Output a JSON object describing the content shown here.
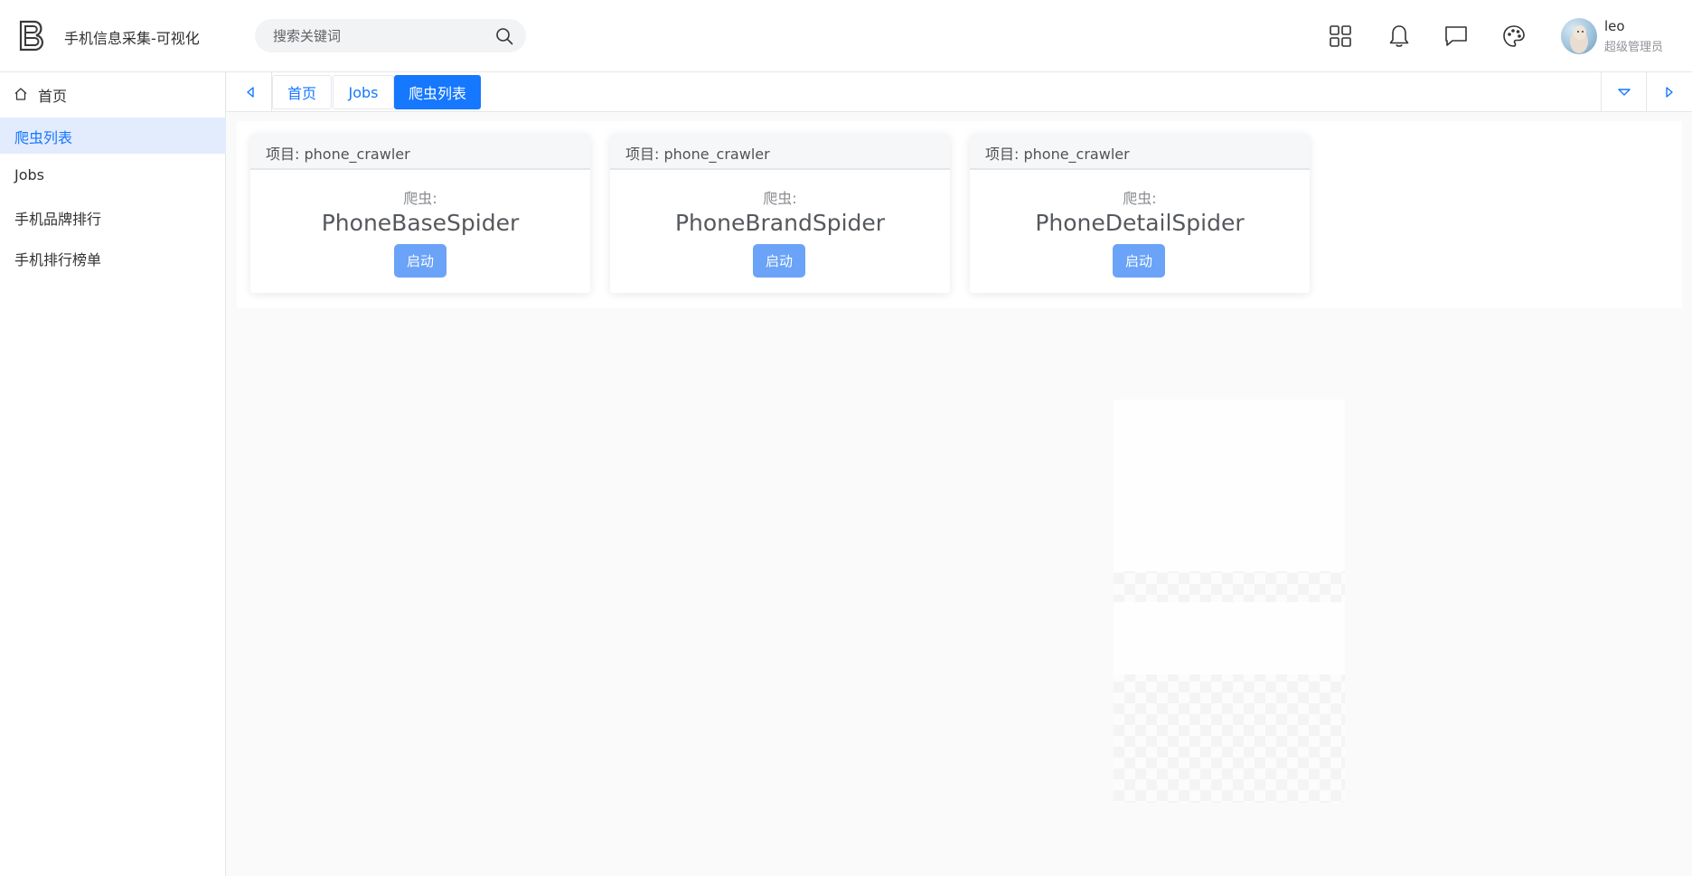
{
  "header": {
    "app_title": "手机信息采集-可视化",
    "search_placeholder": "搜索关键词",
    "icons": [
      "grid-icon",
      "bell-icon",
      "message-icon",
      "palette-icon",
      "search-icon"
    ],
    "user": {
      "name": "leo",
      "role": "超级管理员"
    }
  },
  "sidebar": {
    "items": [
      {
        "label": "首页",
        "icon": "home-icon",
        "active": false
      },
      {
        "label": "爬虫列表",
        "active": true
      },
      {
        "label": "Jobs",
        "active": false
      },
      {
        "label": "手机品牌排行",
        "active": false
      },
      {
        "label": "手机排行榜单",
        "active": false
      }
    ]
  },
  "tabs": {
    "items": [
      {
        "label": "首页",
        "active": false
      },
      {
        "label": "Jobs",
        "active": false
      },
      {
        "label": "爬虫列表",
        "active": true
      }
    ],
    "icons": [
      "caret-left-icon",
      "caret-down-icon",
      "caret-right-icon"
    ]
  },
  "cards": [
    {
      "project": "项目: phone_crawler",
      "spider_label": "爬虫:",
      "spider_name": "PhoneBaseSpider",
      "button": "启动"
    },
    {
      "project": "项目: phone_crawler",
      "spider_label": "爬虫:",
      "spider_name": "PhoneBrandSpider",
      "button": "启动"
    },
    {
      "project": "项目: phone_crawler",
      "spider_label": "爬虫:",
      "spider_name": "PhoneDetailSpider",
      "button": "启动"
    }
  ],
  "colors": {
    "accent": "#1677ff",
    "button": "#6aa3f7",
    "active_menu_bg": "#e2ecfd"
  }
}
